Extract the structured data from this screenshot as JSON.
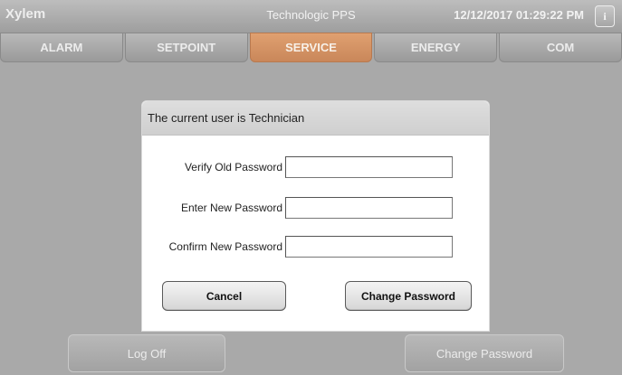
{
  "header": {
    "brand": "Xylem",
    "title": "Technologic PPS",
    "clock": "12/12/2017 01:29:22 PM",
    "info_icon": "i"
  },
  "tabs": [
    {
      "label": "ALARM",
      "active": false
    },
    {
      "label": "SETPOINT",
      "active": false
    },
    {
      "label": "SERVICE",
      "active": true
    },
    {
      "label": "ENERGY",
      "active": false
    },
    {
      "label": "COM",
      "active": false
    }
  ],
  "background": {
    "ghost_text": "The current user is Technician",
    "logoff_label": "Log Off",
    "change_password_label": "Change Password"
  },
  "dialog": {
    "title": "The current user is Technician",
    "fields": [
      {
        "label": "Verify Old Password",
        "value": ""
      },
      {
        "label": "Enter New Password",
        "value": ""
      },
      {
        "label": "Confirm New Password",
        "value": ""
      }
    ],
    "cancel_label": "Cancel",
    "submit_label": "Change Password"
  },
  "colors": {
    "active_tab": "#d99565",
    "chrome": "#a9a9a9"
  }
}
